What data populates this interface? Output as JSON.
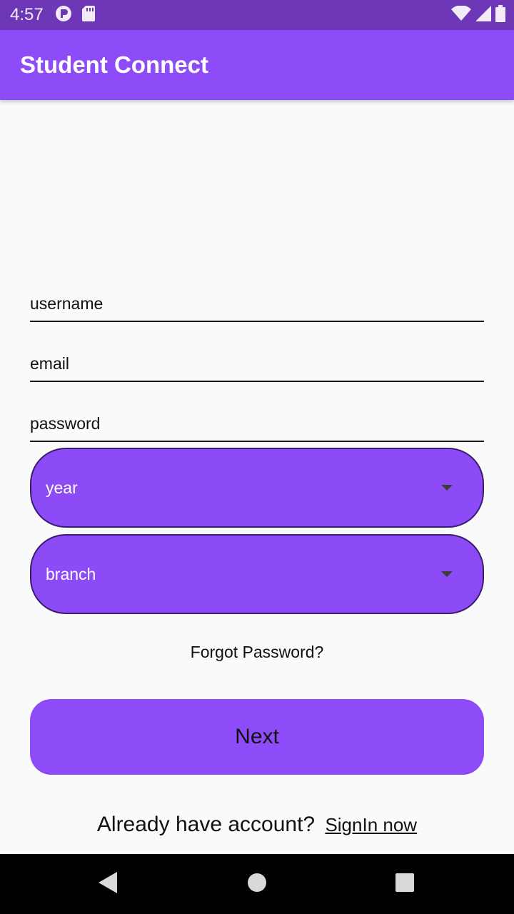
{
  "status_bar": {
    "time": "4:57",
    "icons": [
      "app-notification-icon",
      "sd-card-icon",
      "wifi-icon",
      "cellular-signal-icon",
      "battery-icon"
    ]
  },
  "app_bar": {
    "title": "Student Connect",
    "color": "#8e4cf8"
  },
  "form": {
    "username_placeholder": "username",
    "email_placeholder": "email",
    "password_placeholder": "password",
    "year_dropdown": {
      "selected": "year"
    },
    "branch_dropdown": {
      "selected": "branch"
    },
    "forgot_password": "Forgot Password?",
    "next_label": "Next"
  },
  "footer": {
    "prompt": "Already have account?",
    "signin_link": "SignIn now"
  },
  "nav_bar": {
    "icons": [
      "back-icon",
      "home-icon",
      "recents-icon"
    ]
  },
  "colors": {
    "accent": "#8e4cf8",
    "status_bar": "#6d37b8",
    "background": "#fafafa"
  }
}
